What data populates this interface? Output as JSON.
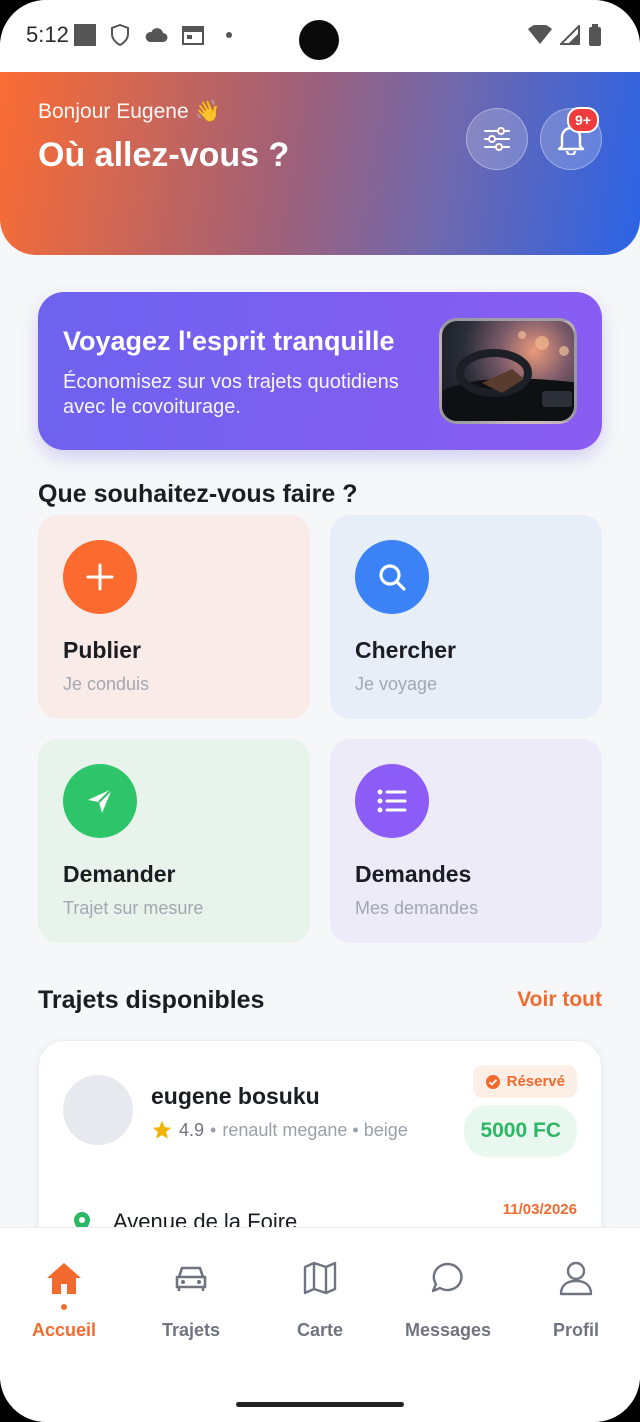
{
  "status_bar": {
    "time": "5:12"
  },
  "header": {
    "greeting": "Bonjour Eugene 👋",
    "title": "Où allez-vous ?",
    "notification_badge": "9+"
  },
  "promo": {
    "title": "Voyagez l'esprit tranquille",
    "subtitle": "Économisez sur vos trajets quotidiens avec le covoiturage."
  },
  "actions": {
    "section_title": "Que souhaitez-vous faire ?",
    "items": [
      {
        "title": "Publier",
        "subtitle": "Je conduis",
        "icon": "plus-icon",
        "color": "#fb6a2e",
        "bg": "#f9ebe7"
      },
      {
        "title": "Chercher",
        "subtitle": "Je voyage",
        "icon": "search-icon",
        "color": "#3b82f6",
        "bg": "#e8eef8"
      },
      {
        "title": "Demander",
        "subtitle": "Trajet sur mesure",
        "icon": "send-icon",
        "color": "#2ec56a",
        "bg": "#e8f3ec"
      },
      {
        "title": "Demandes",
        "subtitle": "Mes demandes",
        "icon": "list-icon",
        "color": "#8b5cf6",
        "bg": "#eeebf8"
      }
    ]
  },
  "trips": {
    "section_title": "Trajets disponibles",
    "see_all": "Voir tout",
    "items": [
      {
        "driver": "eugene bosuku",
        "rating": "4.9",
        "vehicle": "renault megane • beige",
        "status": "Réservé",
        "price": "5000 FC",
        "origin": "Avenue de la Foire",
        "date": "11/03/2026"
      }
    ]
  },
  "nav": {
    "items": [
      {
        "label": "Accueil",
        "icon": "home-icon",
        "active": true
      },
      {
        "label": "Trajets",
        "icon": "car-icon",
        "active": false
      },
      {
        "label": "Carte",
        "icon": "map-icon",
        "active": false
      },
      {
        "label": "Messages",
        "icon": "chat-icon",
        "active": false
      },
      {
        "label": "Profil",
        "icon": "user-icon",
        "active": false
      }
    ]
  },
  "colors": {
    "accent": "#f26a2e",
    "success": "#2cb765"
  }
}
